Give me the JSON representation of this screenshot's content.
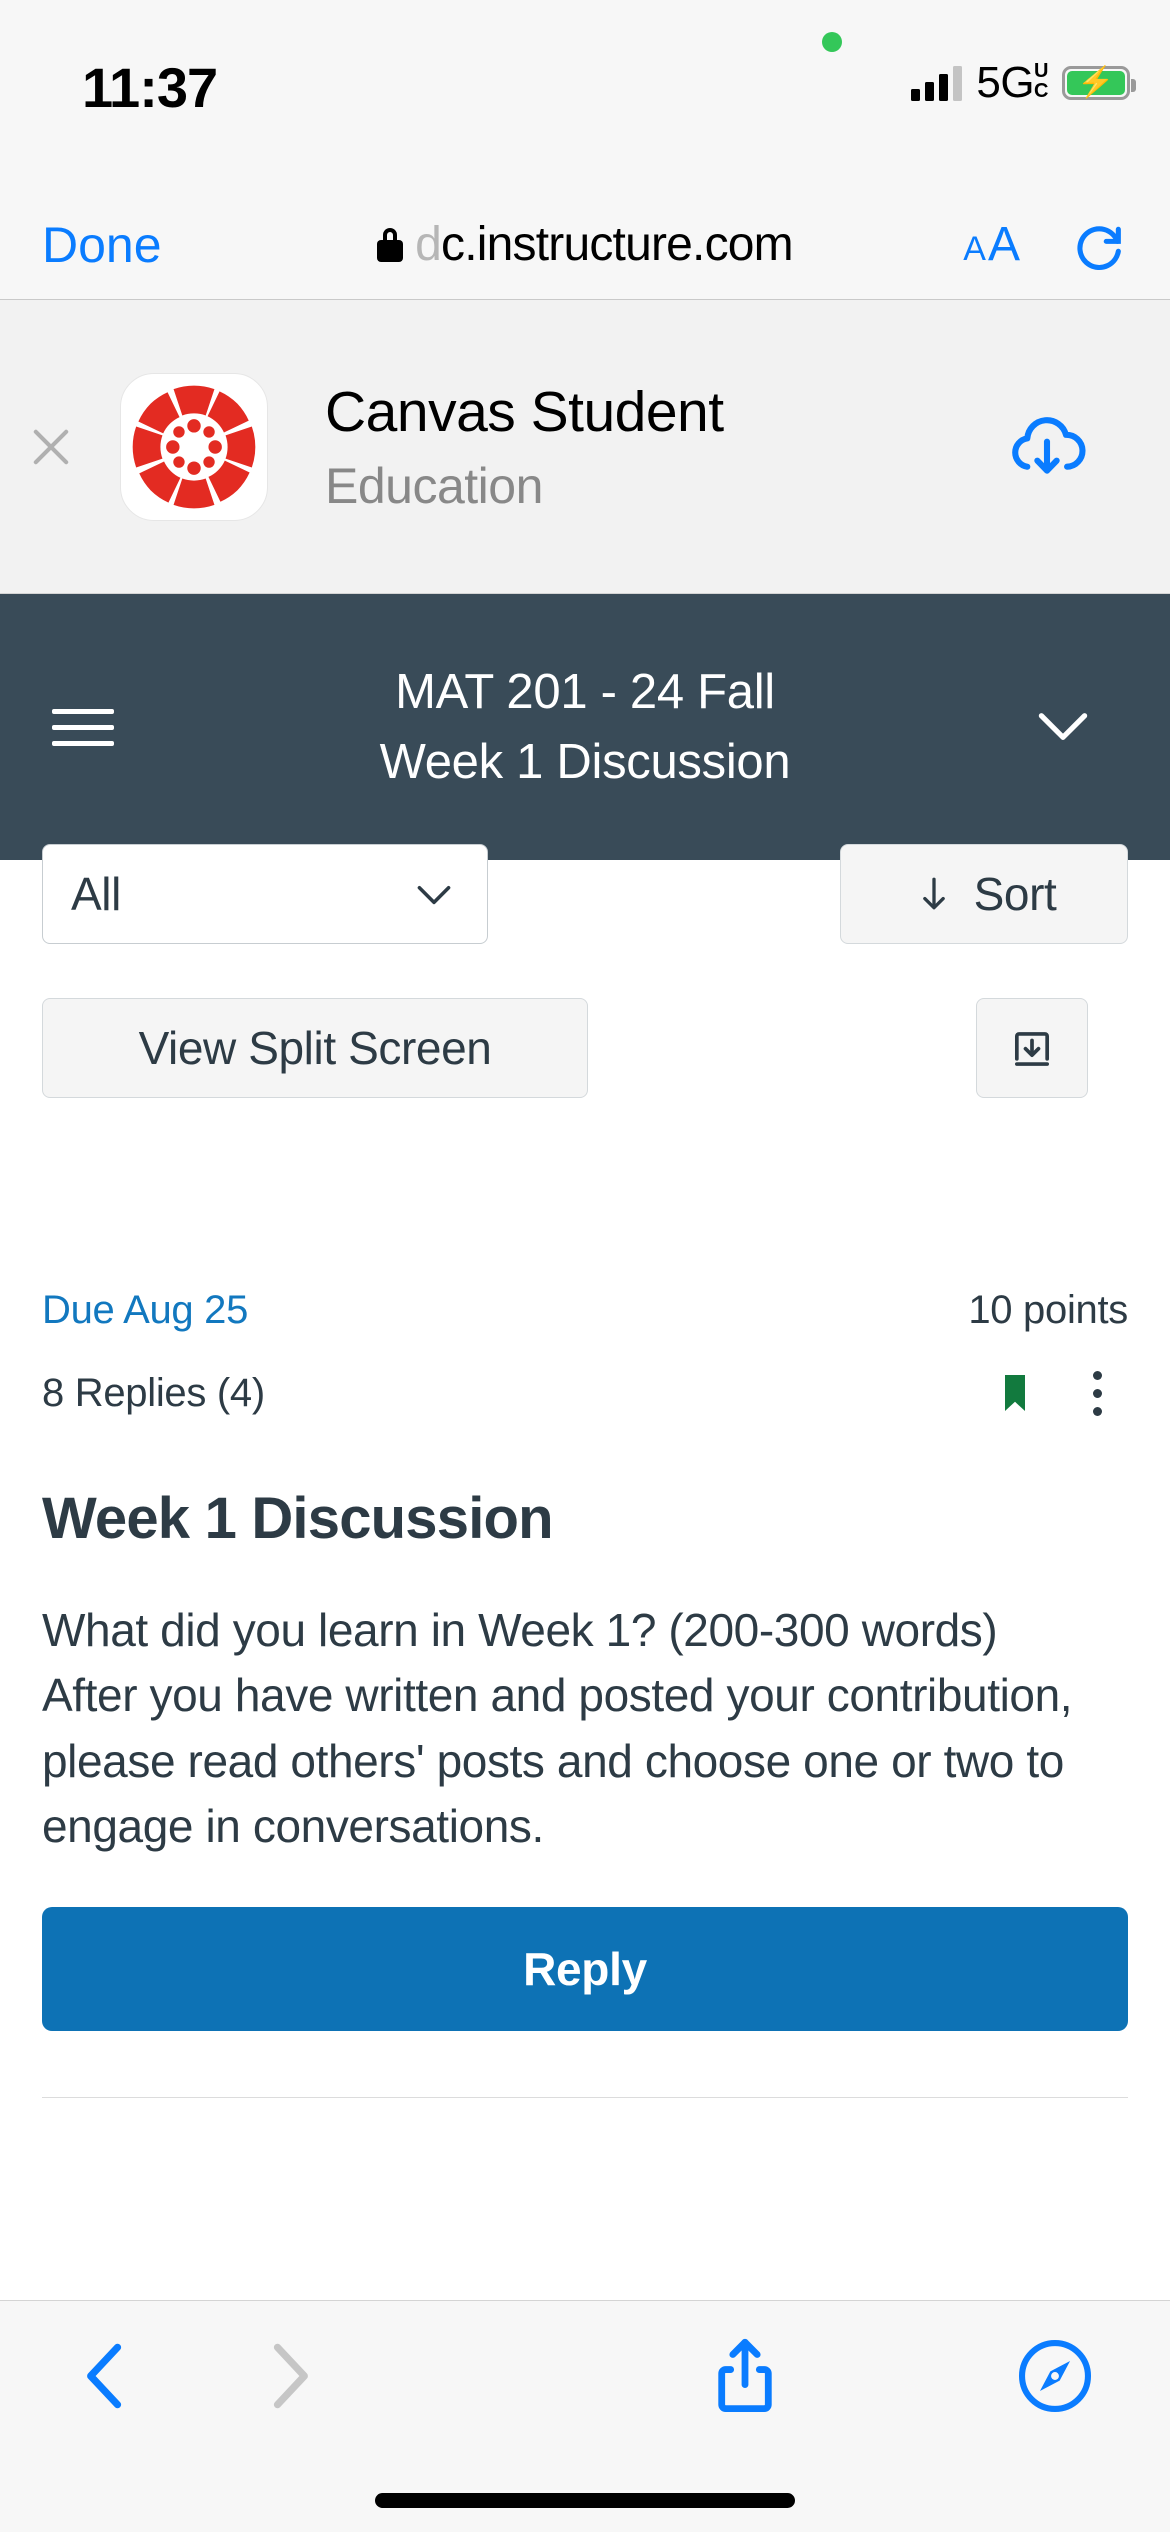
{
  "status_bar": {
    "time": "11:37",
    "network": "5G",
    "network_sub_top": "U",
    "network_sub_bottom": "C",
    "recording_indicator": "green-dot",
    "signal_bars_filled": 3,
    "signal_bars_total": 4,
    "battery_state": "charging",
    "battery_color": "#34c759"
  },
  "browser": {
    "done_label": "Done",
    "url_dim_prefix": "d",
    "url": "c.instructure.com",
    "lock_icon": "lock-icon",
    "text_size_small": "A",
    "text_size_large": "A",
    "reload_icon": "reload-icon",
    "accent_color": "#0a7cff"
  },
  "app_banner": {
    "close_icon": "close-icon",
    "app_name": "Canvas Student",
    "category": "Education",
    "action_icon": "cloud-download-icon",
    "logo_color": "#e32b22"
  },
  "canvas_header": {
    "menu_icon": "hamburger-menu-icon",
    "course": "MAT 201 - 24 Fall",
    "page": "Week 1 Discussion",
    "collapse_icon": "chevron-down-icon",
    "background": "#394b58"
  },
  "toolbar": {
    "filter_value": "All",
    "filter_chevron": "chevron-down-icon",
    "sort_label": "Sort",
    "sort_icon": "arrow-down-icon",
    "split_screen_label": "View Split Screen",
    "expand_threads_icon": "expand-threads-icon"
  },
  "discussion": {
    "due_label": "Due Aug 25",
    "points": "10 points",
    "replies": "8 Replies (4)",
    "bookmark_icon": "bookmark-icon",
    "bookmark_color": "#127a3e",
    "menu_icon": "kebab-menu-icon",
    "title": "Week 1 Discussion",
    "body_line_1": "What did you learn in Week 1? (200-300 words)",
    "body_line_2": "After you have written and posted your contribution, please read others' posts and choose one or two to engage in conversations.",
    "reply_label": "Reply",
    "reply_color": "#0d72b5",
    "link_color": "#1278bf",
    "text_color": "#2d3b45"
  },
  "bottom_bar": {
    "back_icon": "chevron-left-icon",
    "forward_icon": "chevron-right-icon",
    "share_icon": "share-icon",
    "tabs_icon": "safari-compass-icon",
    "back_enabled": true,
    "forward_enabled": false
  }
}
